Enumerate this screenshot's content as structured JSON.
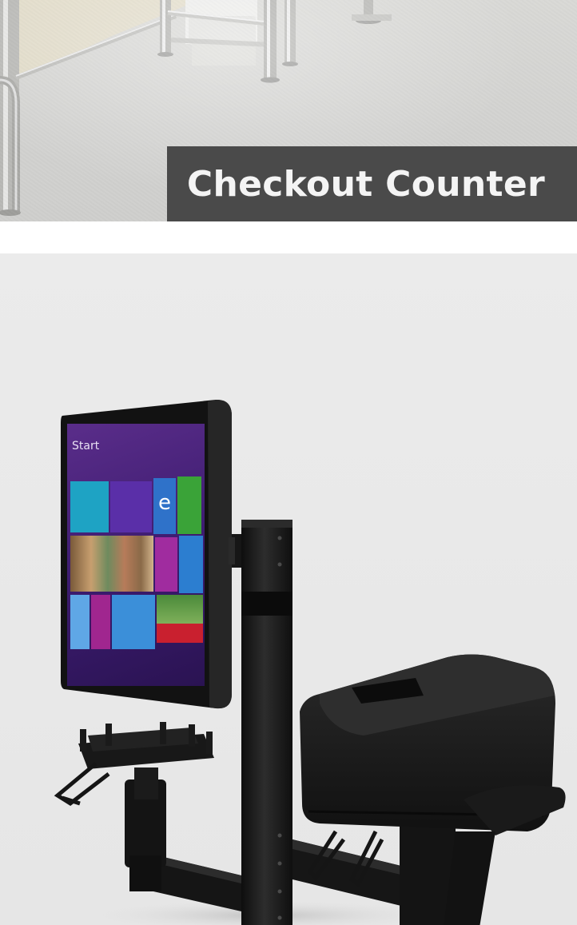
{
  "banner": {
    "caption": "Checkout Counter"
  },
  "screen": {
    "start_label": "Start"
  },
  "colors": {
    "caption_bg": "#4a4a4a",
    "caption_text": "#f4f4f4",
    "product_bg": "#e8e8e8",
    "hardware": "#1b1b1b",
    "screen_purple": "#4a2680"
  }
}
